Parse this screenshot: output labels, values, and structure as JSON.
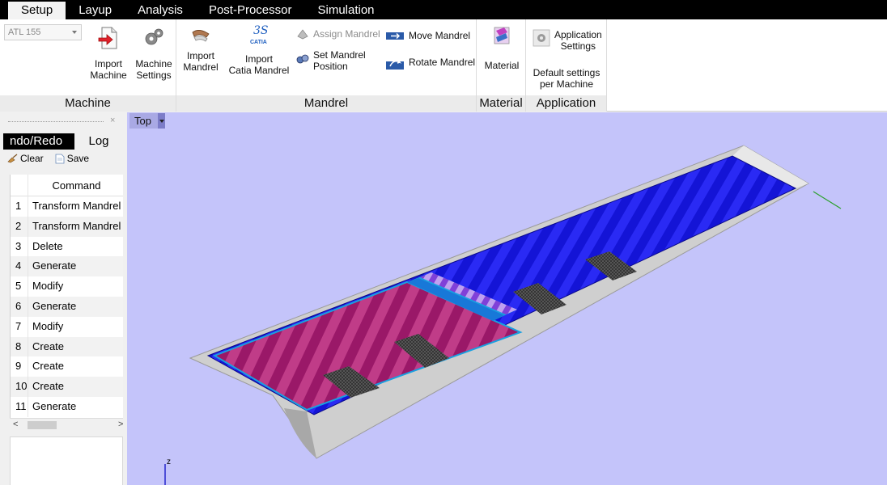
{
  "menu": {
    "tabs": [
      "Setup",
      "Layup",
      "Analysis",
      "Post-Processor",
      "Simulation"
    ],
    "active": "Setup"
  },
  "ribbon": {
    "machine_combo": "ATL 155",
    "groups": {
      "machine": {
        "label": "Machine",
        "import_machine": "Import\nMachine",
        "machine_settings": "Machine\nSettings"
      },
      "mandrel": {
        "label": "Mandrel",
        "import_mandrel": "Import\nMandrel",
        "import_catia": "Import\nCatia Mandrel",
        "catia_logo": "CATIA",
        "assign_mandrel": "Assign Mandrel",
        "set_mandrel_position": "Set Mandrel\nPosition",
        "move_mandrel": "Move Mandrel",
        "rotate_mandrel": "Rotate Mandrel"
      },
      "material": {
        "label": "Material",
        "material": "Material"
      },
      "application": {
        "label": "Application",
        "application_settings": "Application\nSettings",
        "default_settings": "Default settings\nper Machine"
      }
    }
  },
  "left_panel": {
    "tabs": [
      "ndo/Redo",
      "Log"
    ],
    "clear": "Clear",
    "save": "Save",
    "close": "×",
    "command_header": "Command",
    "commands": [
      {
        "n": "1",
        "c": "Transform Mandrel"
      },
      {
        "n": "2",
        "c": "Transform Mandrel"
      },
      {
        "n": "3",
        "c": "Delete"
      },
      {
        "n": "4",
        "c": "Generate"
      },
      {
        "n": "5",
        "c": "Modify"
      },
      {
        "n": "6",
        "c": "Generate"
      },
      {
        "n": "7",
        "c": "Modify"
      },
      {
        "n": "8",
        "c": "Create"
      },
      {
        "n": "9",
        "c": "Create"
      },
      {
        "n": "10",
        "c": "Create"
      },
      {
        "n": "11",
        "c": "Generate"
      }
    ]
  },
  "viewport": {
    "view": "Top",
    "axis_label": "z",
    "background": "#c4c4fa"
  },
  "colors": {
    "ply_blue": "#1010e0",
    "ply_magenta": "#a01070",
    "surface_gray": "#c8c8c8",
    "accent_cyan": "#18a8e8"
  }
}
